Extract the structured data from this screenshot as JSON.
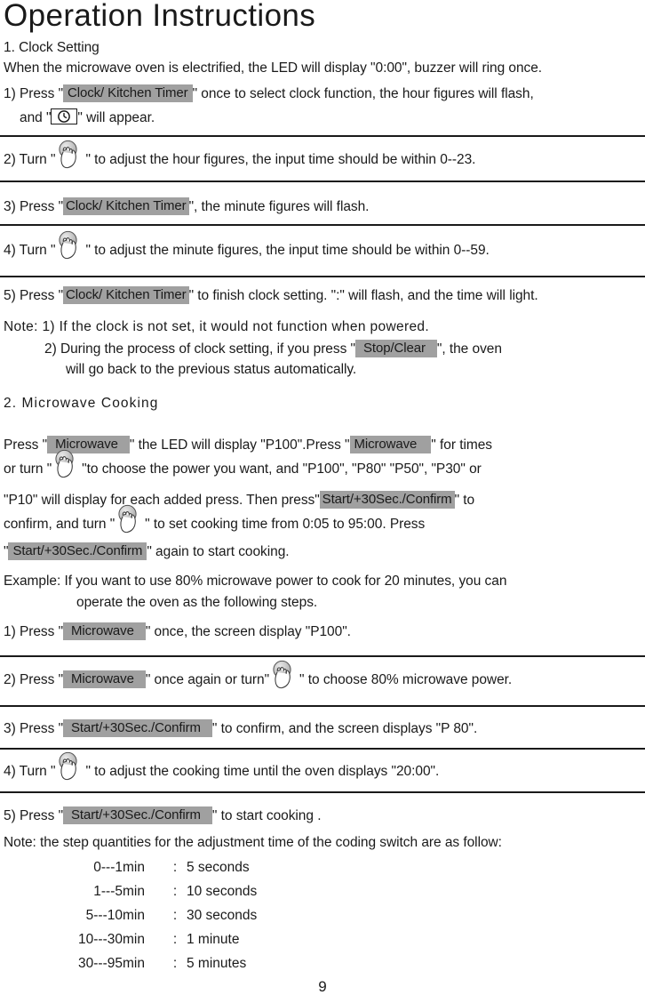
{
  "document": {
    "title": "Operation Instructions",
    "page_number": "9"
  },
  "colors": {
    "button_highlight": "#a0a0a0",
    "text": "#1a1a1a",
    "rule": "#1a1a1a",
    "page_background": "#ffffff"
  },
  "buttons": {
    "clock_kitchen_timer": "Clock/ Kitchen Timer",
    "stop_clear": "Stop/Clear",
    "microwave": "Microwave",
    "start_confirm": "Start/+30Sec./Confirm"
  },
  "icons": {
    "knob": "turn-knob-hand-icon",
    "clock": "clock-icon"
  },
  "section1": {
    "heading": "1. Clock Setting",
    "intro": "When the microwave oven is electrified, the LED will display \"0:00\", buzzer will ring once.",
    "step1_a": "1) Press \"",
    "step1_b": "\" once to select clock function, the hour figures will flash,",
    "step1_c": "and  \"",
    "step1_d": "\" will appear.",
    "step2_a": "2) Turn \"",
    "step2_b": "\" to adjust the hour figures, the input time should be within 0--23.",
    "step3_a": "3) Press \"",
    "step3_b": "\", the minute figures will flash.",
    "step4_a": "4) Turn \"",
    "step4_b": "\" to adjust the minute figures, the input time should be within 0--59.",
    "step5_a": "5) Press \"",
    "step5_b": "\" to finish clock setting. \":\" will flash, and the time will light.",
    "note_1": "Note: 1) If the clock is not set, it would not function when powered.",
    "note_2_a": "2) During the process of clock setting, if you press \"",
    "note_2_b": "\", the oven",
    "note_2_c": "will go back to the previous status automatically."
  },
  "section2": {
    "heading": "2. Microwave Cooking",
    "p_l1_a": "Press \"",
    "p_l1_b": "\" the LED will display \"P100\".Press \"",
    "p_l1_c": "\" for times",
    "p_l2_a": " or turn \"",
    "p_l2_b": "\"to choose the power you want, and \"P100\", \"P80\" \"P50\", \"P30\" or",
    "p_l3_a": " \"P10\" will display for each added press. Then press\"",
    "p_l3_b": "\" to",
    "p_l4_a": "confirm, and turn  \"",
    "p_l4_b": "\" to set cooking time from 0:05 to 95:00. Press",
    "p_l5_a": "\"",
    "p_l5_b": "\" again to start cooking.",
    "example_l1": "Example: If you want to use 80% microwave power to cook for 20 minutes, you can",
    "example_l2": "operate the oven as the following steps.",
    "step1_a": "1) Press \"",
    "step1_b": "\" once, the screen display \"P100\".",
    "step2_a": "2) Press \"",
    "step2_b": "\" once again or turn\"",
    "step2_c": "\"  to choose 80% microwave power.",
    "step3_a": "3) Press \"",
    "step3_b": "\" to confirm, and the screen displays \"P 80\".",
    "step4_a": "4) Turn \"",
    "step4_b": "\" to adjust the cooking time until the oven displays \"20:00\".",
    "step5_a": "5) Press \"",
    "step5_b": "\" to start cooking .",
    "note_heading": "Note:  the step quantities for the adjustment time of the coding switch are as follow:",
    "qty_rows": [
      {
        "range": "0---1",
        "unit": "min",
        "colon": ":",
        "value": "5  seconds"
      },
      {
        "range": "1---5",
        "unit": "min",
        "colon": ":",
        "value": "10 seconds"
      },
      {
        "range": "5---10",
        "unit": "min",
        "colon": ":",
        "value": "30 seconds"
      },
      {
        "range": "10---30",
        "unit": "min",
        "colon": ":",
        "value": "1 minute"
      },
      {
        "range": "30---95",
        "unit": "min",
        "colon": ":",
        "value": "5 minutes"
      }
    ]
  }
}
